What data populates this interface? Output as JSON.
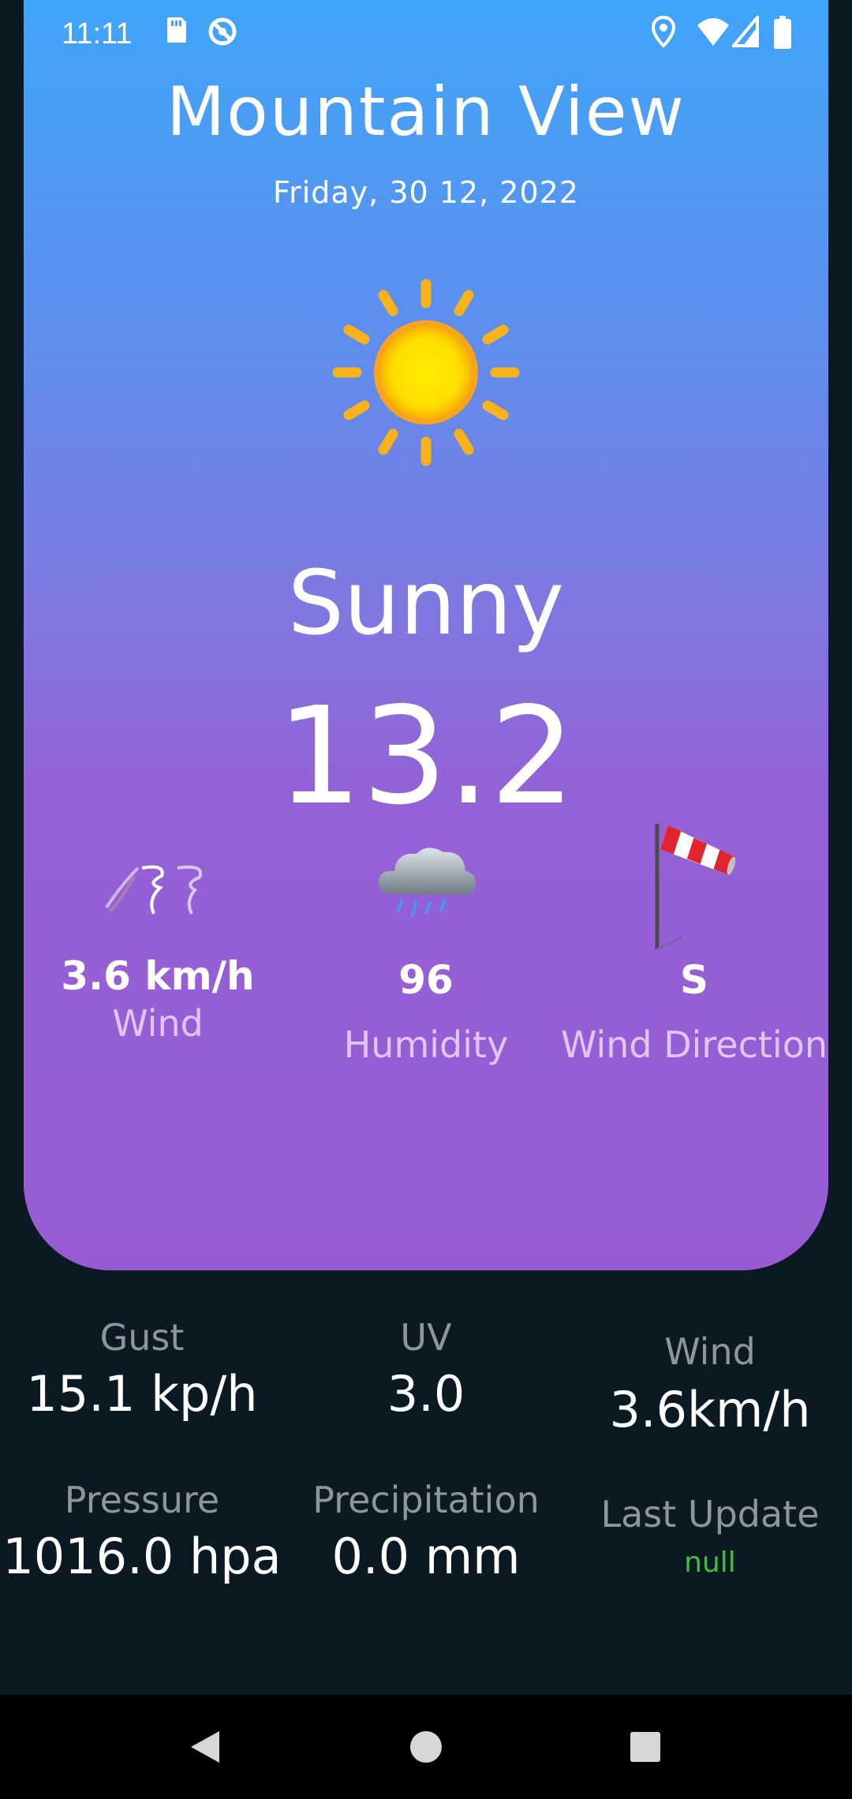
{
  "status_bar": {
    "time": "11:11",
    "icons": [
      "sd-card-icon",
      "sync-disabled-icon",
      "location-icon",
      "wifi-icon",
      "signal-icon",
      "battery-icon"
    ]
  },
  "weather": {
    "city": "Mountain View",
    "date": "Friday, 30 12, 2022",
    "condition": "Sunny",
    "temperature": "13.2",
    "condition_icon": "sun-icon"
  },
  "stats": {
    "wind": {
      "value": "3.6 km/h",
      "label": "Wind",
      "icon": "tornado-icon"
    },
    "humidity": {
      "value": "96",
      "label": "Humidity",
      "icon": "rain-cloud-icon"
    },
    "direction": {
      "value": "S",
      "label": "Wind Direction",
      "icon": "windsock-icon"
    }
  },
  "details": {
    "gust": {
      "label": "Gust",
      "value": "15.1 kp/h"
    },
    "uv": {
      "label": "UV",
      "value": "3.0"
    },
    "wind": {
      "label": "Wind",
      "value": "3.6km/h"
    },
    "pressure": {
      "label": "Pressure",
      "value": "1016.0 hpa"
    },
    "precipitation": {
      "label": "Precipitation",
      "value": "0.0 mm"
    },
    "last_update": {
      "label": "Last Update",
      "value": "null"
    }
  },
  "colors": {
    "gradient_top": "#3fa5f8",
    "gradient_bottom": "#995bd3",
    "background": "#0b1a22",
    "null_text": "#3fbf3f"
  },
  "nav": {
    "icons": [
      "back-icon",
      "home-icon",
      "recents-icon"
    ]
  }
}
